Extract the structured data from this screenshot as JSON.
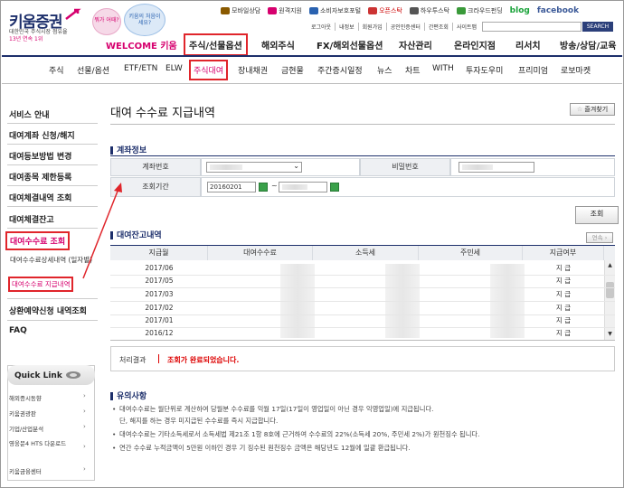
{
  "header": {
    "logo": "키움증권",
    "logo_sub1": "대한민국 주식시장 점유율",
    "logo_sub2": "13년 연속 1위",
    "bubble1": "뭐가 어때?",
    "bubble2": "키움의 처음이세요?",
    "util_links": [
      "모바일상담",
      "원격지원",
      "소비자보호포털",
      "오픈스탁",
      "하우투스탁",
      "크라우드펀딩"
    ],
    "blog": "blog",
    "facebook": "facebook",
    "util2_links": [
      "로그아웃",
      "내정보",
      "회원가입",
      "공인인증센터",
      "간편조회",
      "사이트맵"
    ],
    "search_label": "SEARCH",
    "welcome": "WELCOME 키움",
    "main_menu": [
      "주식/선물옵션",
      "해외주식",
      "FX/해외선물옵션",
      "자산관리",
      "온라인지점",
      "리서치",
      "방송/상담/교육"
    ],
    "sub_menu": [
      "주식",
      "선물/옵션",
      "ETF/ETN",
      "ELW",
      "주식대여",
      "장내채권",
      "금현물",
      "주간증시일정",
      "뉴스",
      "차트",
      "WITH",
      "투자도우미",
      "프리미엄",
      "로보마켓"
    ]
  },
  "sidebar": {
    "items": [
      "서비스 안내",
      "대여계좌 신청/해지",
      "대여등보방법 변경",
      "대여종목 제한등록",
      "대여체결내역 조회",
      "대여체결잔고",
      "대여수수료 조회"
    ],
    "sub_items": [
      "대여수수료상세내역 (일자별)",
      "대여수수료 지급내역"
    ],
    "items2": [
      "상환예약신청 내역조회",
      "FAQ"
    ],
    "quick_link_title": "Quick Link",
    "quick_items": [
      "해외증시동향",
      "키움권광판",
      "기업/산업분석",
      "영웅문4 HTS 다운로드",
      "키움금융센터"
    ]
  },
  "main": {
    "page_title": "대여 수수료 지급내역",
    "favorite": "즐겨찾기",
    "account_section": "계좌정보",
    "account_label": "계좌번호",
    "password_label": "비밀번호",
    "period_label": "조회기간",
    "date_from": "20160201",
    "date_sep": "~",
    "query_button": "조회",
    "balance_section": "대여잔고내역",
    "continue_button": "연속 ›",
    "columns": [
      "지급월",
      "대여수수료",
      "소득세",
      "주민세",
      "지급여부"
    ],
    "rows": [
      {
        "month": "2017/06",
        "status": "지 급"
      },
      {
        "month": "2017/05",
        "status": "지 급"
      },
      {
        "month": "2017/03",
        "status": "지 급"
      },
      {
        "month": "2017/02",
        "status": "지 급"
      },
      {
        "month": "2017/01",
        "status": "지 급"
      },
      {
        "month": "2016/12",
        "status": "지 급"
      }
    ],
    "result_label": "처리결과",
    "result_text": "조회가 완료되었습니다.",
    "notice_title": "유의사항",
    "notices": [
      "대여수수료는 월단위로 계산하여 당월분 수수료를 익월 17일(17일이 영업일이 아닌 경우 익영업일)에 지급됩니다.",
      "단, 해지를 하는 경우 미지급된 수수료를 즉시 지급합니다.",
      "대여수수료는 기타소득세로서 소득세법 제21조 1항 8호에 근거하여 수수료의 22%(소득세 20%, 주민세 2%)가 원천징수 됩니다.",
      "연간 수수료 누적금액이 5만원 이하인 경우 기 징수된 원천징수 금액은 해당년도 12월에 일괄 환급됩니다."
    ]
  },
  "colors": {
    "brand": "#1d2f6b",
    "accent": "#d6006e",
    "highlight": "#e0252b"
  }
}
